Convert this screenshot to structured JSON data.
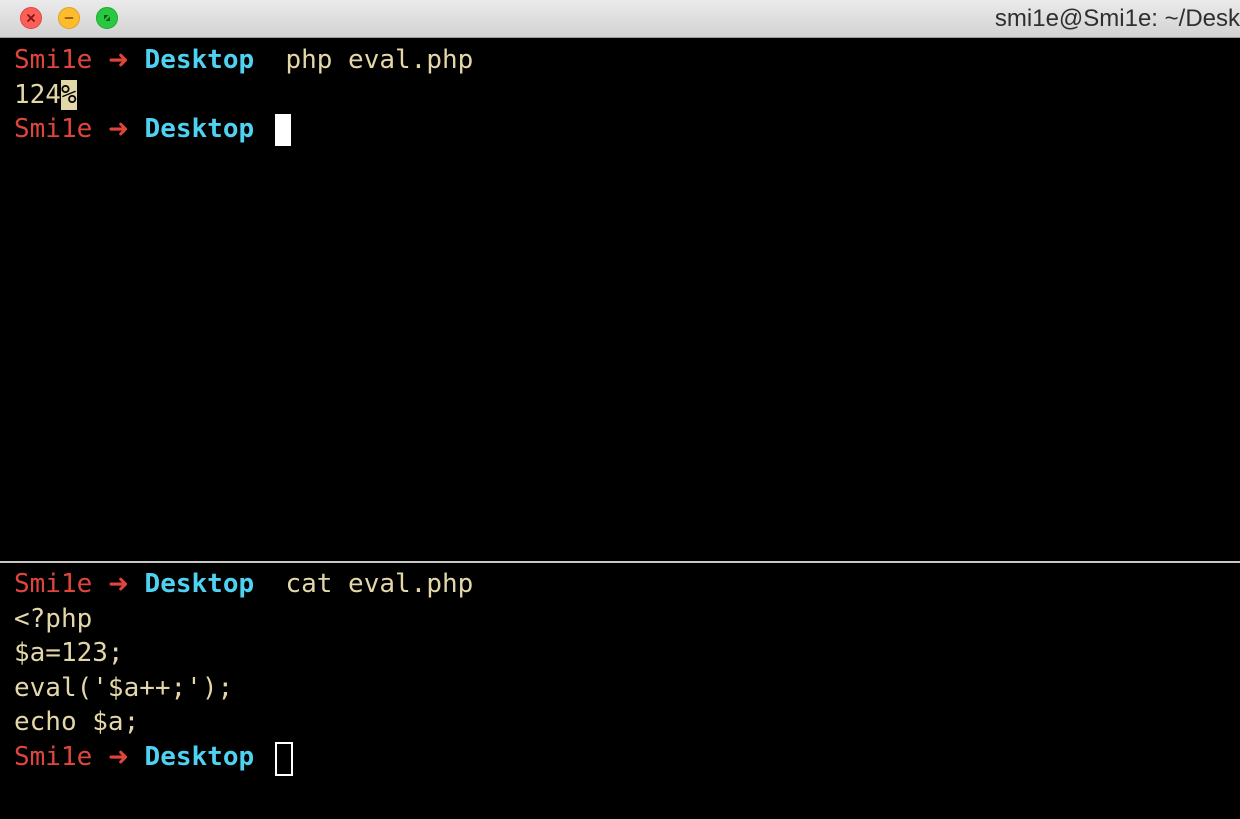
{
  "window": {
    "title": "smi1e@Smi1e: ~/Desk"
  },
  "colors": {
    "user": "#e0453c",
    "directory": "#4fd2f2",
    "text": "#e3d7a8",
    "background": "#000000"
  },
  "prompt": {
    "user": "Smi1e",
    "arrow": "➜",
    "directory": "Desktop"
  },
  "top_pane": {
    "command": "php eval.php",
    "output": "124",
    "output_marker": "%"
  },
  "bottom_pane": {
    "command": "cat eval.php",
    "file_lines": [
      "<?php",
      "$a=123;",
      "eval('$a++;');",
      "echo $a;"
    ]
  }
}
